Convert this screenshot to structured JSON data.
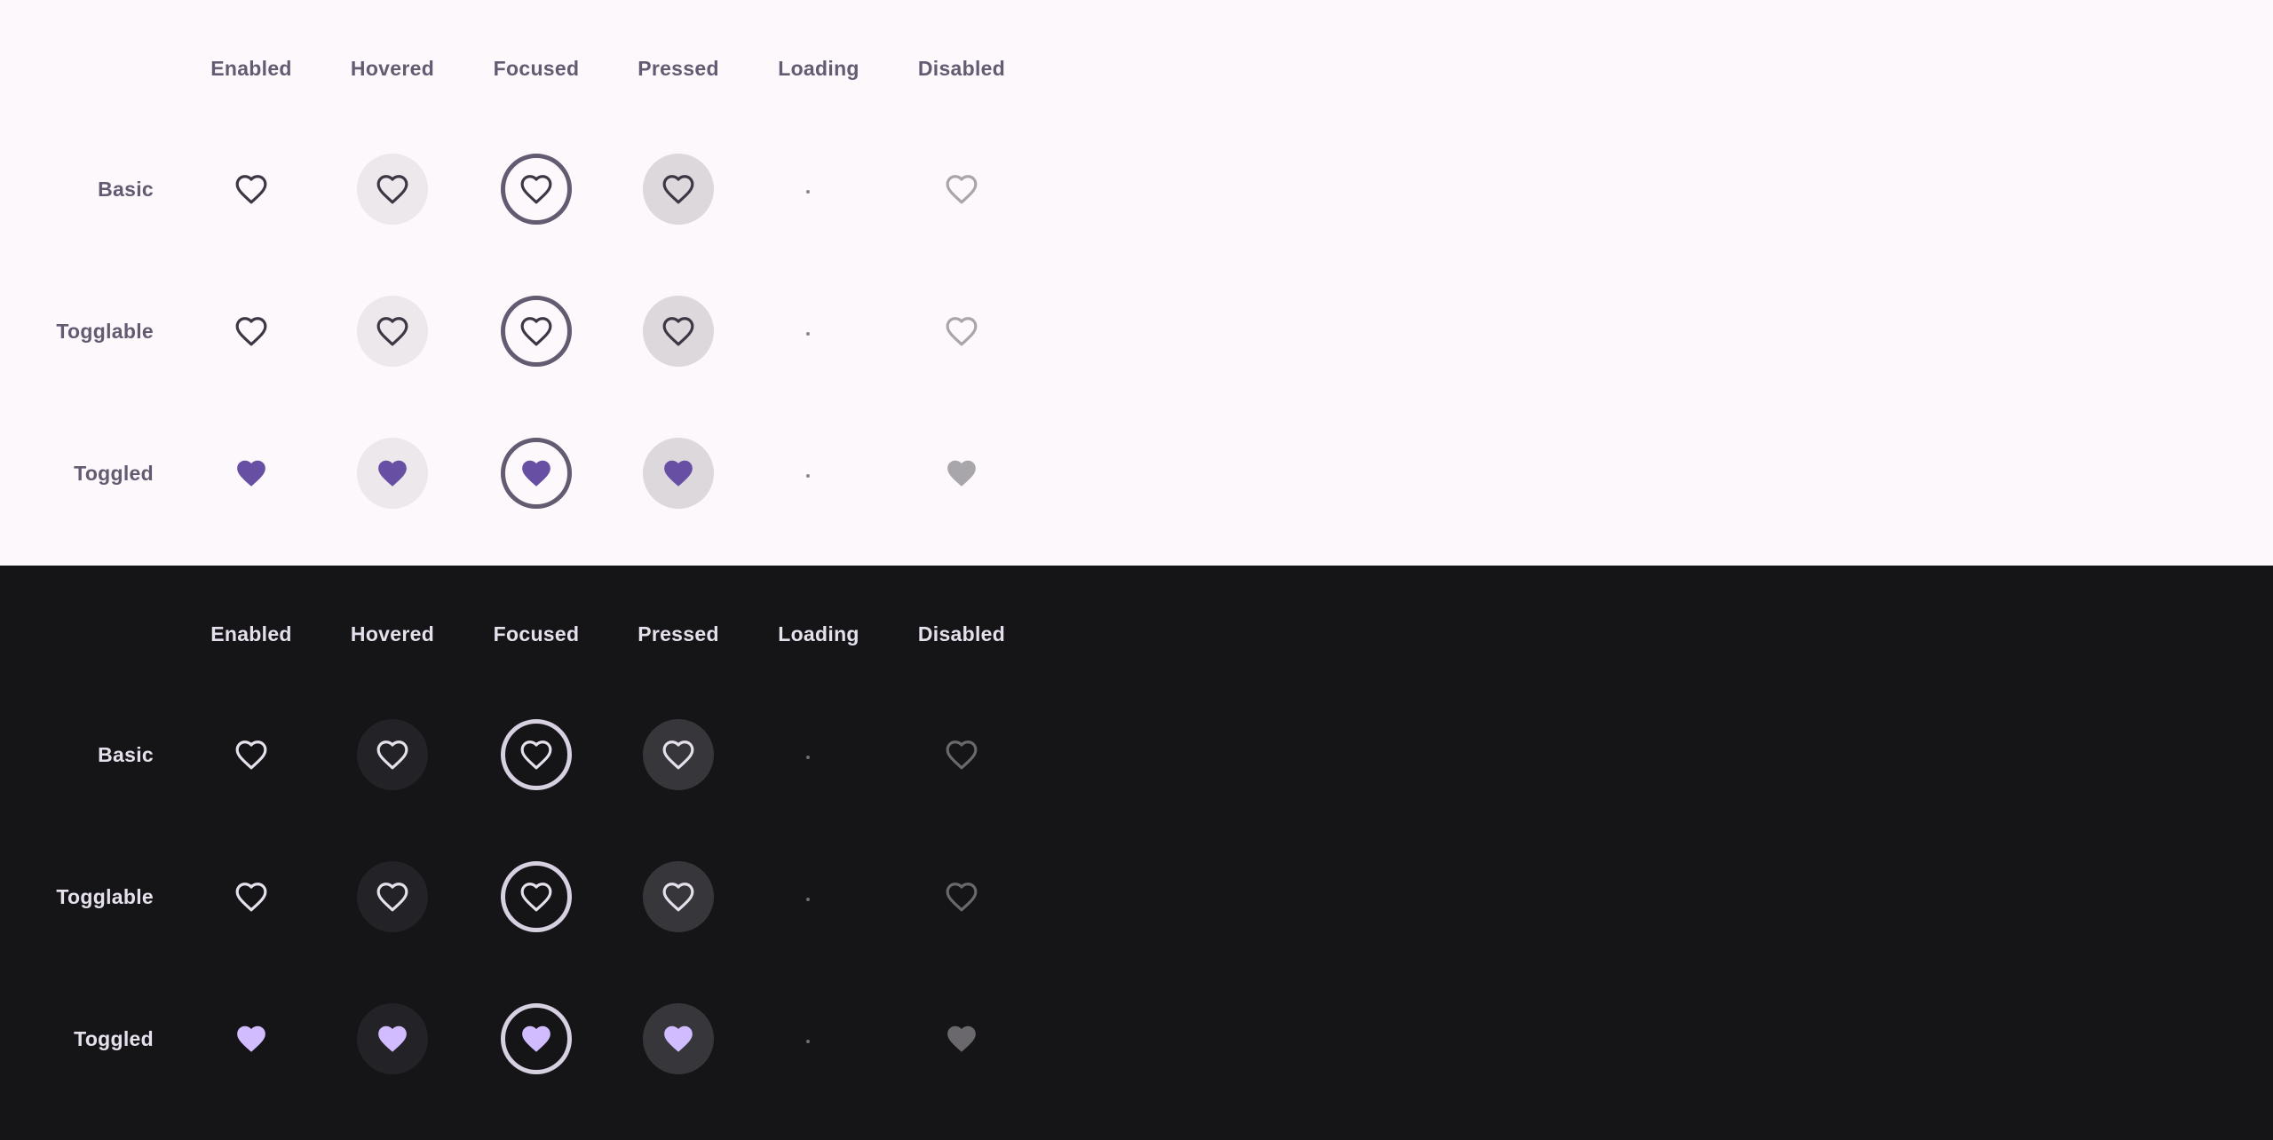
{
  "columns": [
    "Enabled",
    "Hovered",
    "Focused",
    "Pressed",
    "Loading",
    "Disabled"
  ],
  "rows": [
    "Basic",
    "Togglable",
    "Toggled"
  ],
  "themes": {
    "light": {
      "outline_color": "#3c3744",
      "filled_color": "#6750a4",
      "disabled_color": "#a9a6ab"
    },
    "dark": {
      "outline_color": "#e6e0ec",
      "filled_color": "#d0bcff",
      "disabled_color": "#6b686d"
    }
  },
  "icon": "heart-icon"
}
